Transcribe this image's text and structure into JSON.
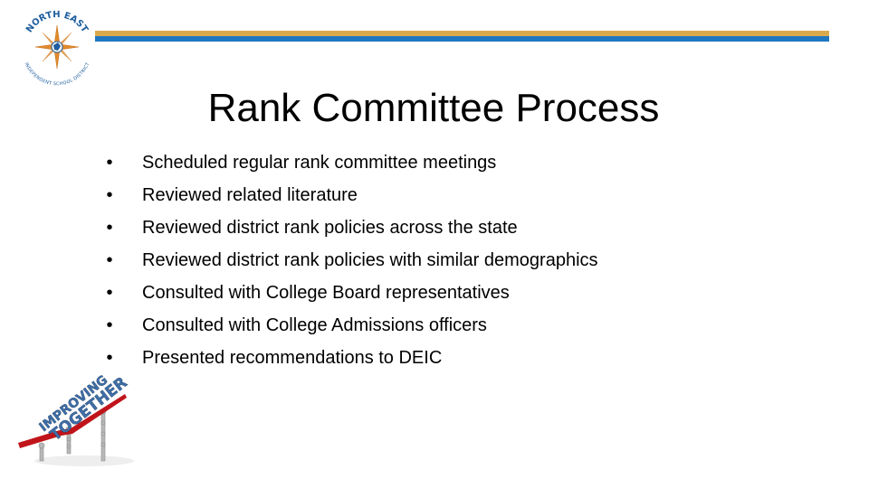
{
  "header": {
    "logo": {
      "icon": "north-east-isd-compass-logo-icon",
      "top_text": "NORTH EAST",
      "bottom_text": "INDEPENDENT SCHOOL DISTRICT"
    },
    "colors": {
      "gold": "#D9AA4C",
      "blue": "#1F77C0"
    }
  },
  "slide": {
    "title": "Rank Committee Process",
    "bullet_glyph": "•",
    "bullets": [
      "Scheduled regular rank committee meetings",
      "Reviewed related literature",
      "Reviewed district rank policies across the state",
      "Reviewed district rank policies with similar demographics",
      "Consulted with College Board representatives",
      "Consulted with College Admissions officers",
      "Presented recommendations to DEIC"
    ]
  },
  "clipart": {
    "icon": "improving-together-arrow-icon",
    "text_line1": "IMPROVING",
    "text_line2": "TOGETHER",
    "colors": {
      "arrow": "#C0141A",
      "text": "#3F6FA8",
      "figures": "#B8B8B8"
    }
  }
}
